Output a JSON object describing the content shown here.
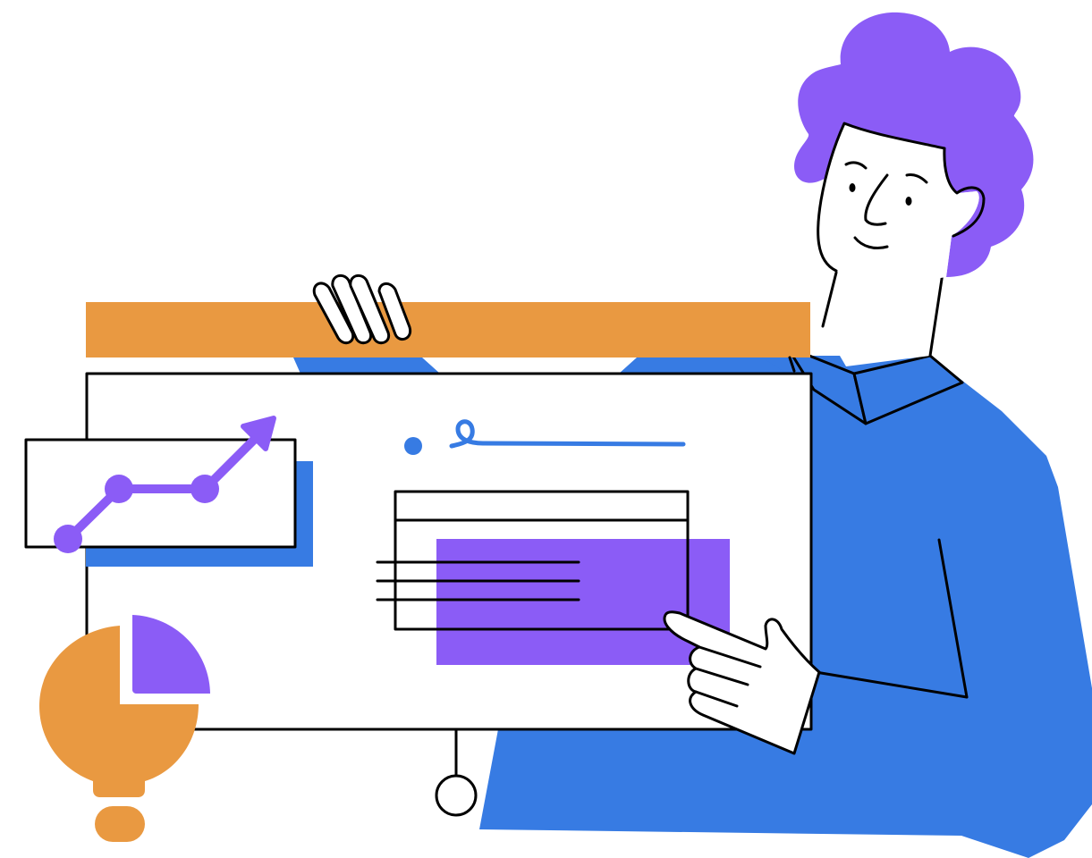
{
  "illustration": {
    "subject": "person-presenting-whiteboard",
    "icons": [
      "line-chart-icon",
      "pie-chart-icon",
      "lightbulb-icon",
      "table-icon"
    ]
  },
  "palette": {
    "purple": "#8b5cf6",
    "blue": "#377be3",
    "orange": "#e99941",
    "ink": "#000000",
    "paper": "#ffffff",
    "skin": "#ffffff"
  }
}
